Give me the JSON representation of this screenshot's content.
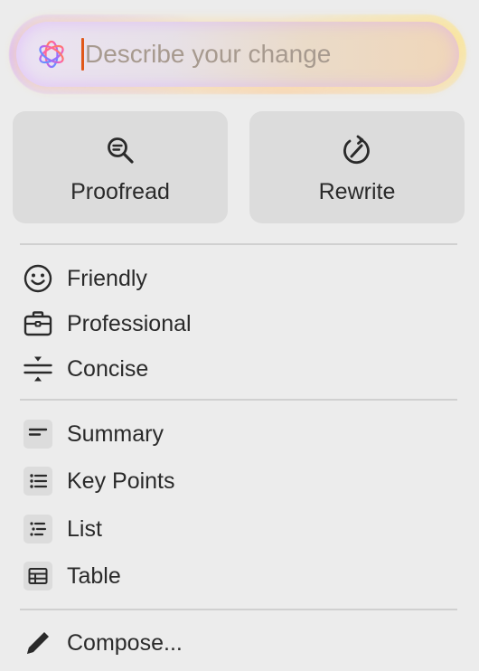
{
  "prompt": {
    "placeholder": "Describe your change",
    "value": ""
  },
  "actions": {
    "proofread": "Proofread",
    "rewrite": "Rewrite"
  },
  "tone": [
    {
      "label": "Friendly",
      "icon": "smiley-icon"
    },
    {
      "label": "Professional",
      "icon": "briefcase-icon"
    },
    {
      "label": "Concise",
      "icon": "compress-icon"
    }
  ],
  "format": [
    {
      "label": "Summary",
      "icon": "summary-icon"
    },
    {
      "label": "Key Points",
      "icon": "bullet-list-icon"
    },
    {
      "label": "List",
      "icon": "list-icon"
    },
    {
      "label": "Table",
      "icon": "table-icon"
    }
  ],
  "compose": {
    "label": "Compose...",
    "icon": "pencil-icon"
  },
  "colors": {
    "caret": "#e0581a",
    "panel": "#ececec",
    "button": "#dcdcdc"
  }
}
